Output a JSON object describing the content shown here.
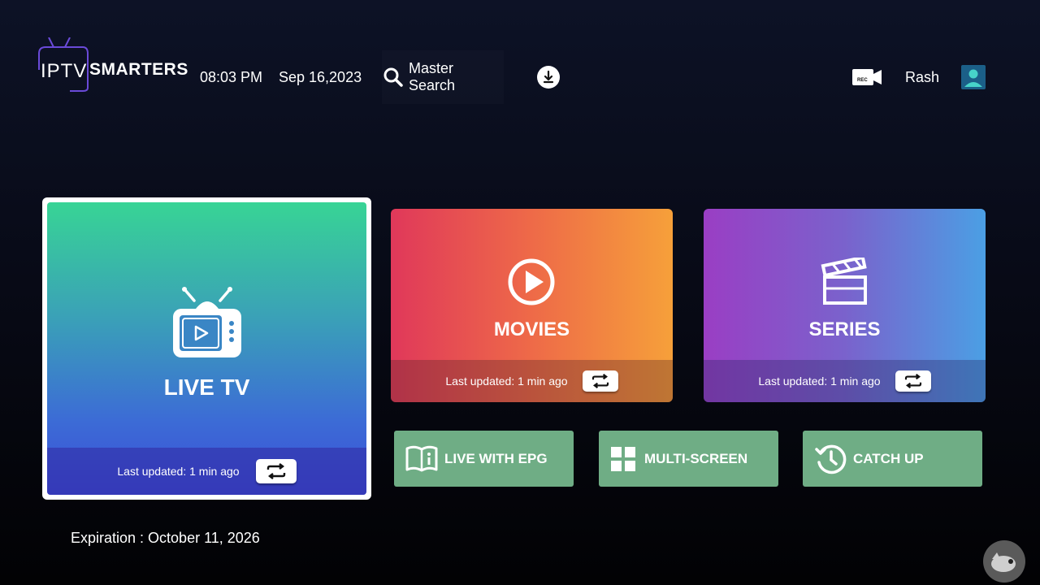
{
  "header": {
    "logo_iptv": "IPTV",
    "logo_smarters": "SMARTERS",
    "time": "08:03 PM",
    "date": "Sep 16,2023",
    "search_label": "Master Search",
    "rec_label": "REC",
    "username": "Rash"
  },
  "tiles": {
    "live_tv": {
      "title": "LIVE TV",
      "updated": "Last updated: 1 min ago"
    },
    "movies": {
      "title": "MOVIES",
      "updated": "Last updated: 1 min ago"
    },
    "series": {
      "title": "SERIES",
      "updated": "Last updated: 1 min ago"
    }
  },
  "quick_tiles": {
    "live_epg": "LIVE WITH EPG",
    "multi_screen": "MULTI-SCREEN",
    "catch_up": "CATCH UP"
  },
  "footer": {
    "expiration": "Expiration : October 11, 2026"
  },
  "icons": {
    "search": "search-icon",
    "download": "download-icon",
    "record": "record-camera-icon",
    "avatar": "user-avatar-icon",
    "tv": "tv-icon",
    "play": "play-circle-icon",
    "clapper": "clapperboard-icon",
    "book": "book-info-icon",
    "grid": "grid-icon",
    "history": "history-icon",
    "refresh": "refresh-icon"
  },
  "colors": {
    "background": "#070914",
    "quick_tile": "#6fad85",
    "live_gradient_top": "#38d495",
    "live_gradient_bottom": "#3a4fd8",
    "movies_gradient_left": "#e0385a",
    "movies_gradient_right": "#f6a03a",
    "series_gradient_left": "#9a3ec4",
    "series_gradient_right": "#4b9fe4"
  }
}
